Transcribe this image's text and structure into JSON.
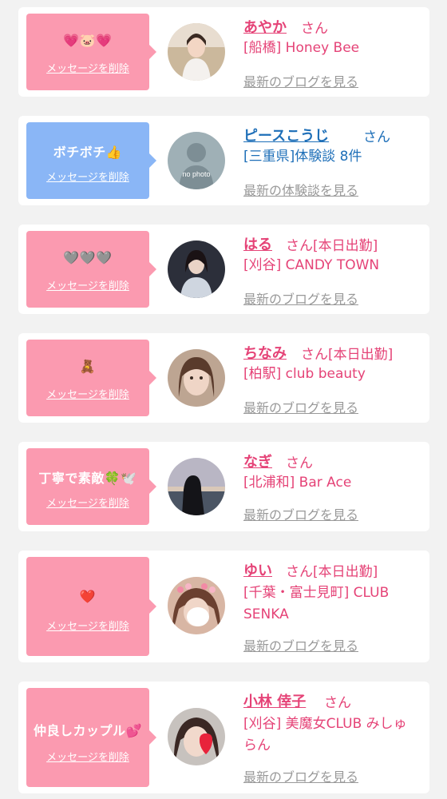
{
  "cards": [
    {
      "message": "💗🐷💗",
      "delete_label": "メッセージを削除",
      "name": "あやか",
      "honorific": "さん",
      "shop": "[船橋] Honey Bee",
      "link": "最新のブログを見る",
      "bubble_color": "#fb9ab0"
    },
    {
      "message": "ボチボチ👍",
      "delete_label": "メッセージを削除",
      "name": "ピースこうじ",
      "honorific": "さん",
      "shop": "[三重県]体験談 8件",
      "link": "最新の体験談を見る",
      "bubble_color": "#8ab6f6",
      "avatar_text": "no photo"
    },
    {
      "message": "🩶🩶🩶",
      "delete_label": "メッセージを削除",
      "name": "はる",
      "honorific": "さん[本日出勤]",
      "shop": "[刈谷] CANDY TOWN",
      "link": "最新のブログを見る",
      "bubble_color": "#fb9ab0"
    },
    {
      "message": "🧸",
      "delete_label": "メッセージを削除",
      "name": "ちなみ",
      "honorific": "さん[本日出勤]",
      "shop": "[柏駅] club beauty",
      "link": "最新のブログを見る",
      "bubble_color": "#fb9ab0"
    },
    {
      "message": "丁寧で素敵🍀🕊️",
      "delete_label": "メッセージを削除",
      "name": "なぎ",
      "honorific": "さん",
      "shop": "[北浦和] Bar Ace",
      "link": "最新のブログを見る",
      "bubble_color": "#fb9ab0"
    },
    {
      "message": "❤️",
      "delete_label": "メッセージを削除",
      "name": "ゆい",
      "honorific": "さん[本日出勤]",
      "shop": "[千葉・富士見町] CLUB SENKA",
      "link": "最新のブログを見る",
      "bubble_color": "#fb9ab0"
    },
    {
      "message": "仲良しカップル💕",
      "delete_label": "メッセージを削除",
      "name": "小林 倖子",
      "honorific": "さん",
      "shop": "[刈谷] 美魔女CLUB みしゅらん",
      "link": "最新のブログを見る",
      "bubble_color": "#fb9ab0"
    }
  ],
  "colors": {
    "pink_accent": "#e54377",
    "blue_accent": "#1e6fb8",
    "link_gray": "#999999"
  }
}
